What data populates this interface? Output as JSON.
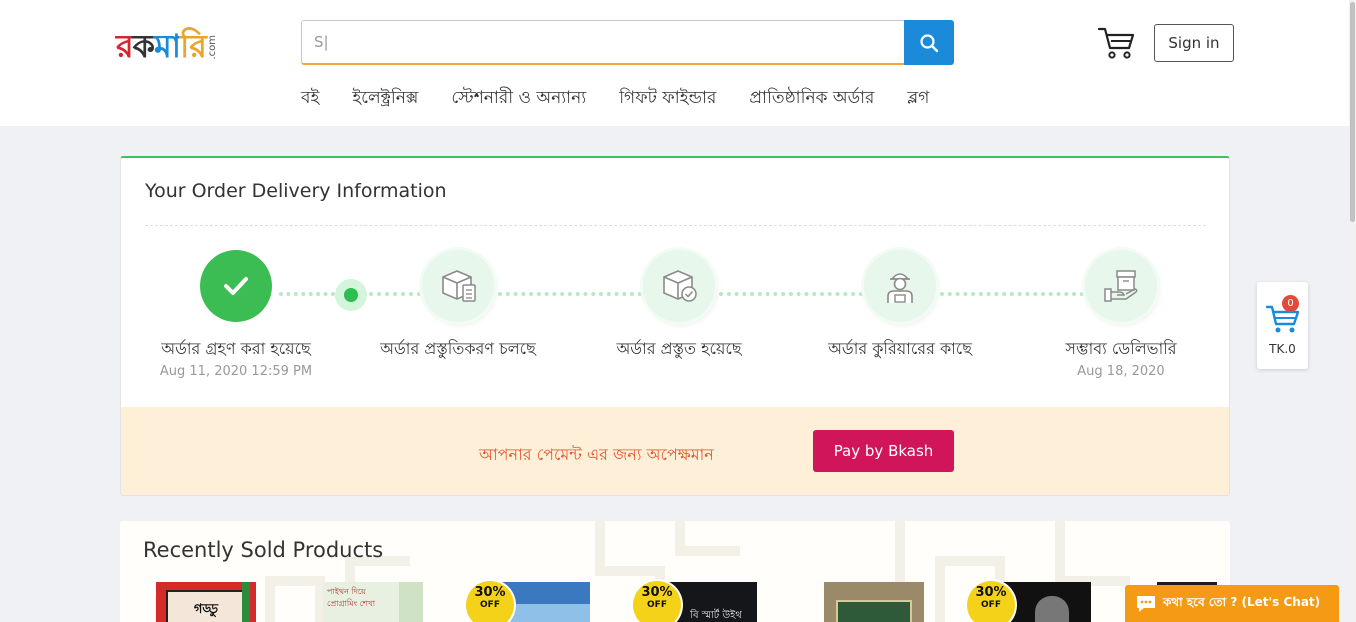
{
  "header": {
    "logo_text": "রকমারি",
    "logo_suffix": ".com",
    "search": {
      "value": "S|",
      "placeholder": ""
    },
    "signin_label": "Sign in",
    "nav": [
      "বই",
      "ইলেক্ট্রনিক্স",
      "স্টেশনারী ও অন্যান্য",
      "গিফট ফাইন্ডার",
      "প্রাতিষ্ঠানিক অর্ডার",
      "ব্লগ"
    ]
  },
  "order": {
    "title": "Your Order Delivery Information",
    "steps": [
      {
        "label": "অর্ডার গ্রহণ করা হয়েছে",
        "date": "Aug 11, 2020 12:59 PM",
        "icon": "check-icon",
        "done": true
      },
      {
        "label": "অর্ডার প্রস্তুতিকরণ চলছে",
        "date": "",
        "icon": "box-checklist-icon",
        "done": false
      },
      {
        "label": "অর্ডার প্রস্তুত হয়েছে",
        "date": "",
        "icon": "box-ready-icon",
        "done": false
      },
      {
        "label": "অর্ডার কুরিয়ারের কাছে",
        "date": "",
        "icon": "courier-icon",
        "done": false
      },
      {
        "label": "সম্ভাব্য ডেলিভারি",
        "date": "Aug 18, 2020",
        "icon": "hand-box-icon",
        "done": false
      }
    ],
    "payment_text": "আপনার পেমেন্ট এর জন্য অপেক্ষমান",
    "pay_button": "Pay by Bkash"
  },
  "recent": {
    "title": "Recently Sold Products",
    "books": [
      {
        "title_text": "গড্ডু",
        "discount": ""
      },
      {
        "title_text": "পাইথন দিয়ে প্রোগ্রামিং শেখা",
        "discount": ""
      },
      {
        "title_text": "",
        "discount": "30%"
      },
      {
        "title_text": "বি স্মার্ট উইথ",
        "discount": "30%"
      },
      {
        "title_text": "",
        "discount": ""
      },
      {
        "title_text": "",
        "discount": "30%"
      }
    ],
    "badge_off": "OFF"
  },
  "float_cart": {
    "count": "0",
    "amount": "TK.0"
  },
  "chat": {
    "label": "কথা হবে তো ? (Let's Chat)"
  },
  "colors": {
    "accent_blue": "#1b8ad8",
    "success_green": "#3cbd54",
    "bkash": "#d1155a",
    "chat_orange": "#f59a15"
  }
}
